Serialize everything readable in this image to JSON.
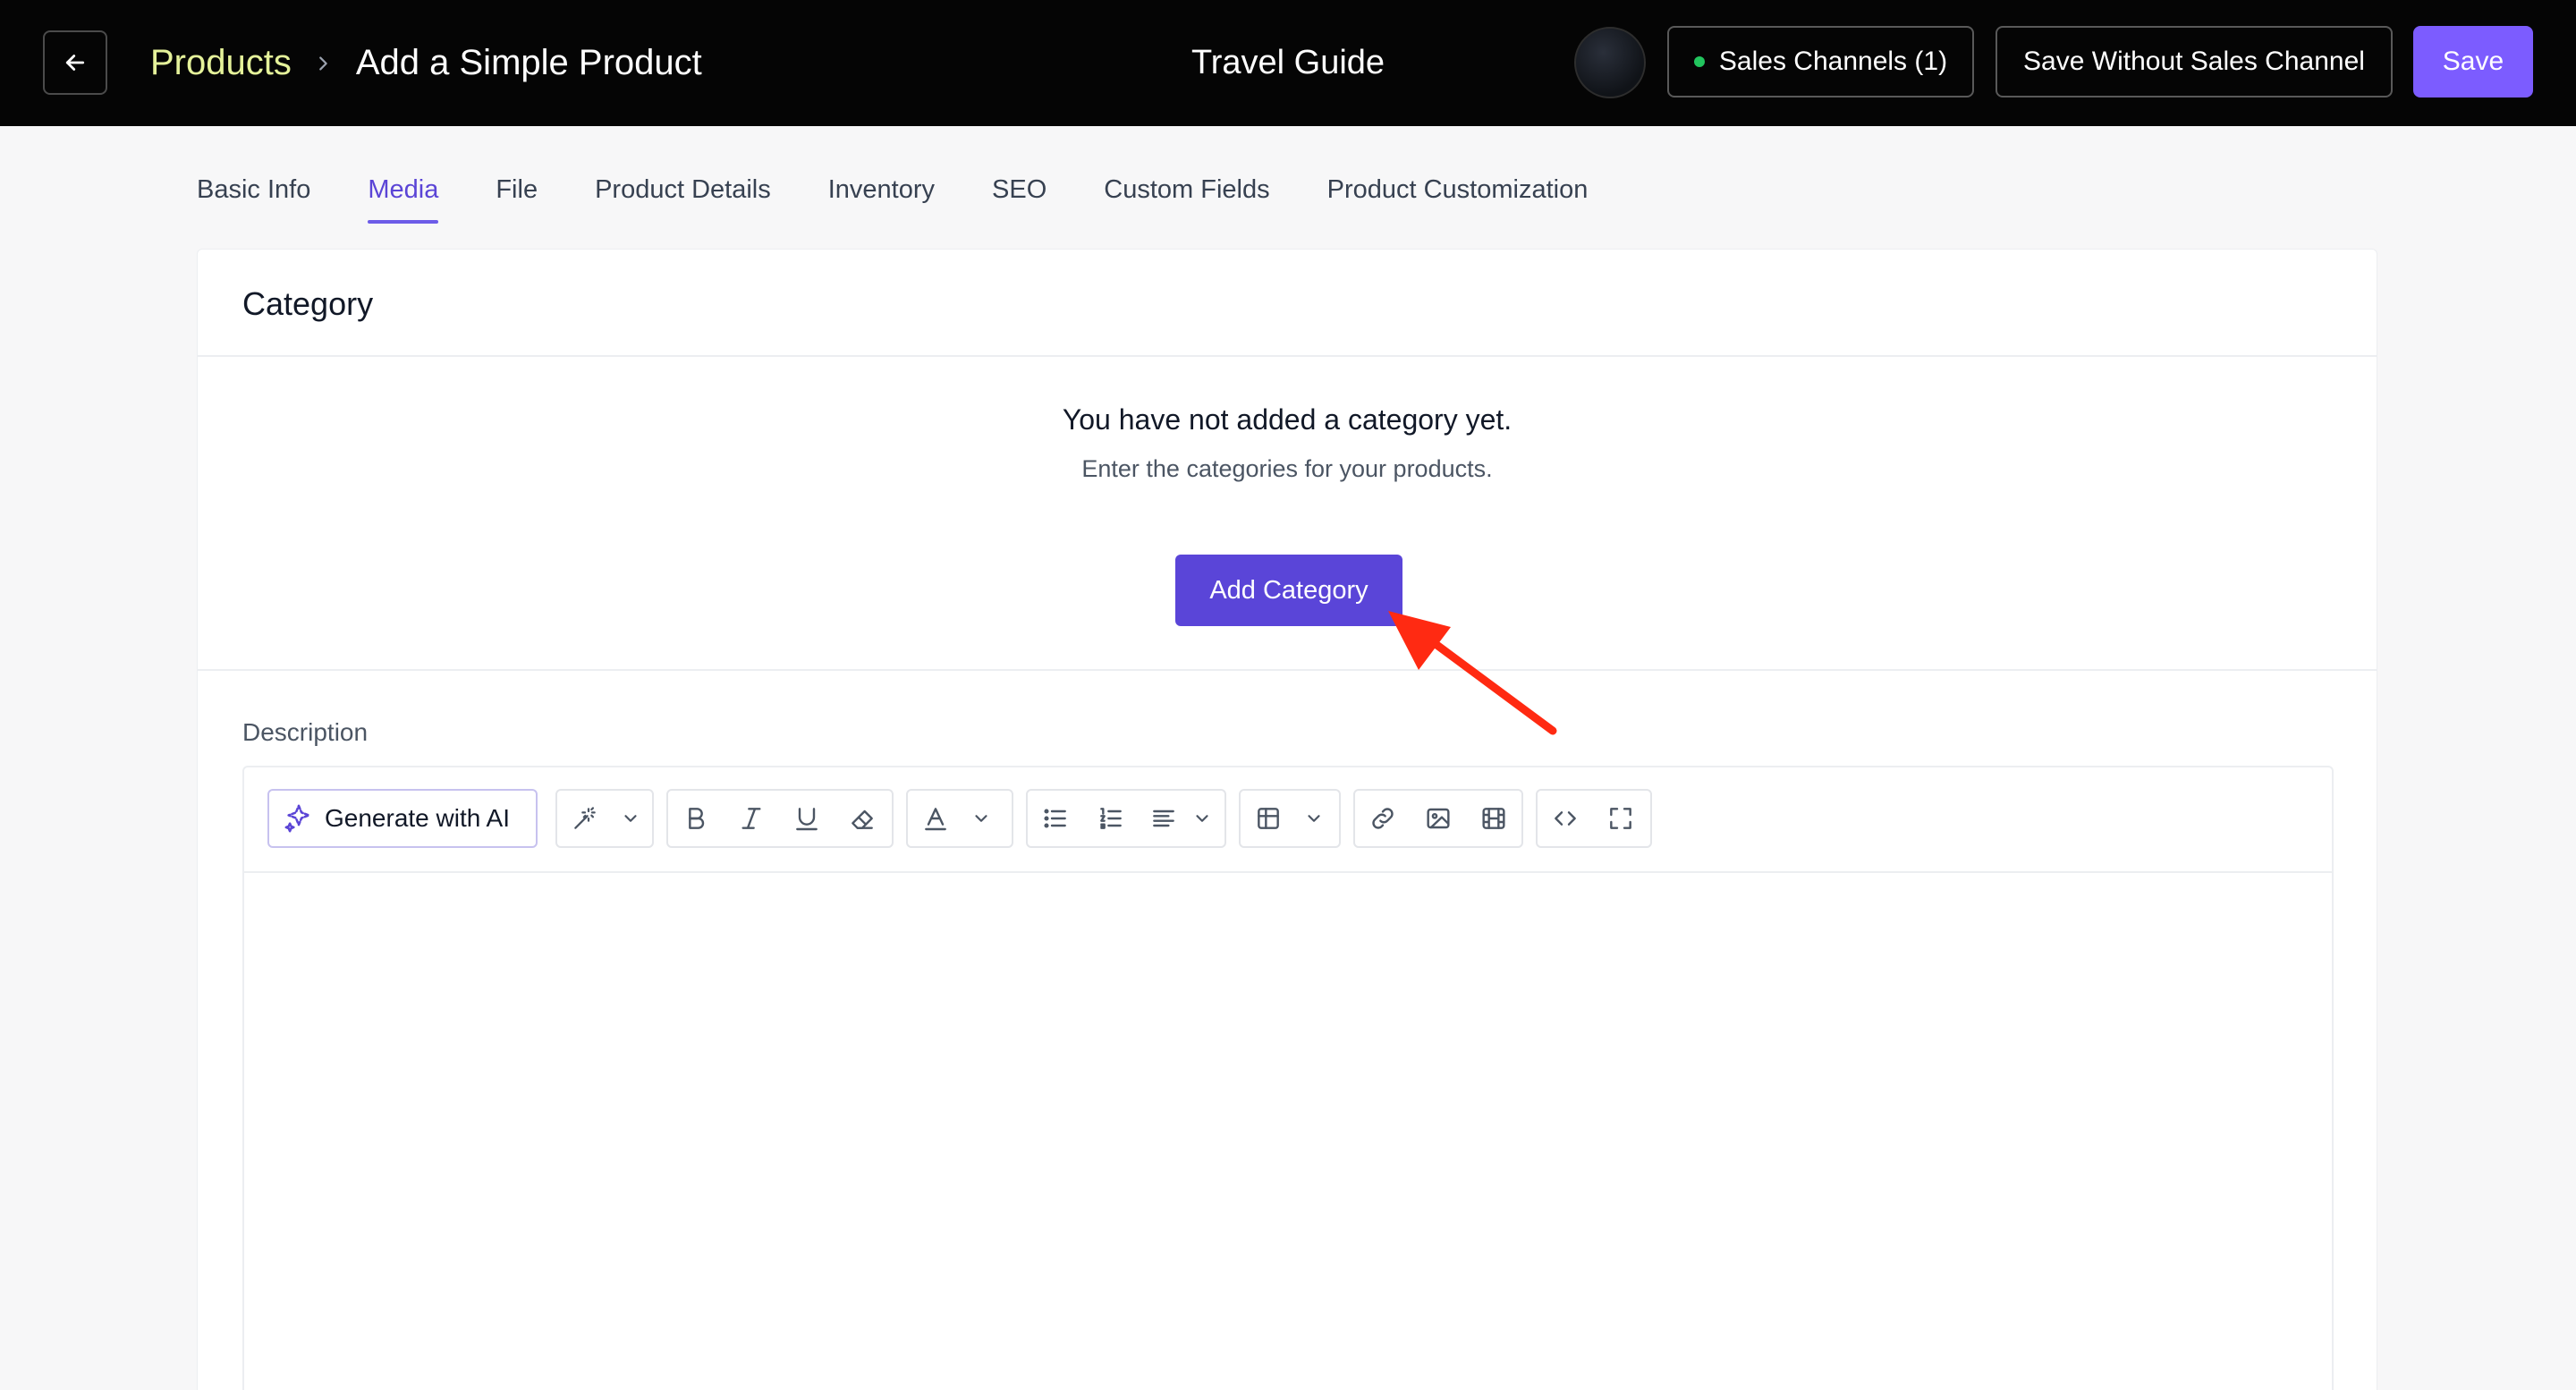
{
  "header": {
    "breadcrumb_root": "Products",
    "breadcrumb_current": "Add a Simple Product",
    "store_name": "Travel Guide",
    "sales_channels_label": "Sales Channels (1)",
    "save_without_label": "Save Without Sales Channel",
    "save_label": "Save",
    "status_color": "#22c55e",
    "accent_color": "#7c5cff",
    "breadcrumb_color": "#e5f29a"
  },
  "tabs": [
    {
      "label": "Basic Info",
      "active": false
    },
    {
      "label": "Media",
      "active": true
    },
    {
      "label": "File",
      "active": false
    },
    {
      "label": "Product Details",
      "active": false
    },
    {
      "label": "Inventory",
      "active": false
    },
    {
      "label": "SEO",
      "active": false
    },
    {
      "label": "Custom Fields",
      "active": false
    },
    {
      "label": "Product Customization",
      "active": false
    }
  ],
  "category": {
    "title": "Category",
    "empty_title": "You have not added a category yet.",
    "empty_subtitle": "Enter the categories for your products.",
    "add_button": "Add Category"
  },
  "description": {
    "label": "Description",
    "generate_ai_label": "Generate with AI",
    "toolbar_icons": [
      "magic-wand-icon",
      "bold-icon",
      "italic-icon",
      "underline-icon",
      "eraser-icon",
      "font-color-icon",
      "bullet-list-icon",
      "numbered-list-icon",
      "align-icon",
      "table-icon",
      "link-icon",
      "image-icon",
      "video-icon",
      "code-view-icon",
      "fullscreen-icon"
    ]
  },
  "annotation": {
    "arrow_color": "#ff2a12"
  }
}
